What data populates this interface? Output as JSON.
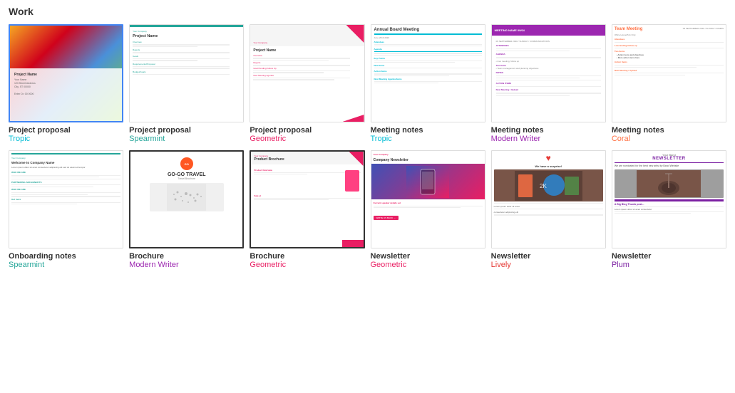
{
  "page": {
    "title": "Work"
  },
  "templates": [
    {
      "id": "proj-proposal-tropic",
      "label": "Project proposal",
      "sublabel": "Tropic",
      "sublabel_color": "color-tropic",
      "selected": true,
      "highlighted": false
    },
    {
      "id": "proj-proposal-spearmint",
      "label": "Project proposal",
      "sublabel": "Spearmint",
      "sublabel_color": "color-spearmint",
      "selected": false,
      "highlighted": false
    },
    {
      "id": "proj-proposal-geometric",
      "label": "Project proposal",
      "sublabel": "Geometric",
      "sublabel_color": "color-geometric",
      "selected": false,
      "highlighted": false
    },
    {
      "id": "meeting-notes-tropic",
      "label": "Meeting notes",
      "sublabel": "Tropic",
      "sublabel_color": "color-tropic",
      "selected": false,
      "highlighted": false
    },
    {
      "id": "meeting-notes-modern-writer",
      "label": "Meeting notes",
      "sublabel": "Modern Writer",
      "sublabel_color": "color-modern-writer",
      "selected": false,
      "highlighted": false
    },
    {
      "id": "meeting-notes-coral",
      "label": "Meeting notes",
      "sublabel": "Coral",
      "sublabel_color": "color-coral",
      "selected": false,
      "highlighted": false
    },
    {
      "id": "onboarding-notes-spearmint",
      "label": "Onboarding notes",
      "sublabel": "Spearmint",
      "sublabel_color": "color-spearmint",
      "selected": false,
      "highlighted": false
    },
    {
      "id": "brochure-modern-writer",
      "label": "Brochure",
      "sublabel": "Modern Writer",
      "sublabel_color": "color-modern-writer",
      "selected": false,
      "highlighted": true
    },
    {
      "id": "brochure-geometric",
      "label": "Brochure",
      "sublabel": "Geometric",
      "sublabel_color": "color-geometric",
      "selected": false,
      "highlighted": true
    },
    {
      "id": "newsletter-geometric",
      "label": "Newsletter",
      "sublabel": "Geometric",
      "sublabel_color": "color-geometric",
      "selected": false,
      "highlighted": false
    },
    {
      "id": "newsletter-lively",
      "label": "Newsletter",
      "sublabel": "Lively",
      "sublabel_color": "color-lively",
      "selected": false,
      "highlighted": false
    },
    {
      "id": "newsletter-plum",
      "label": "Newsletter",
      "sublabel": "Plum",
      "sublabel_color": "color-plum",
      "selected": false,
      "highlighted": false
    }
  ]
}
